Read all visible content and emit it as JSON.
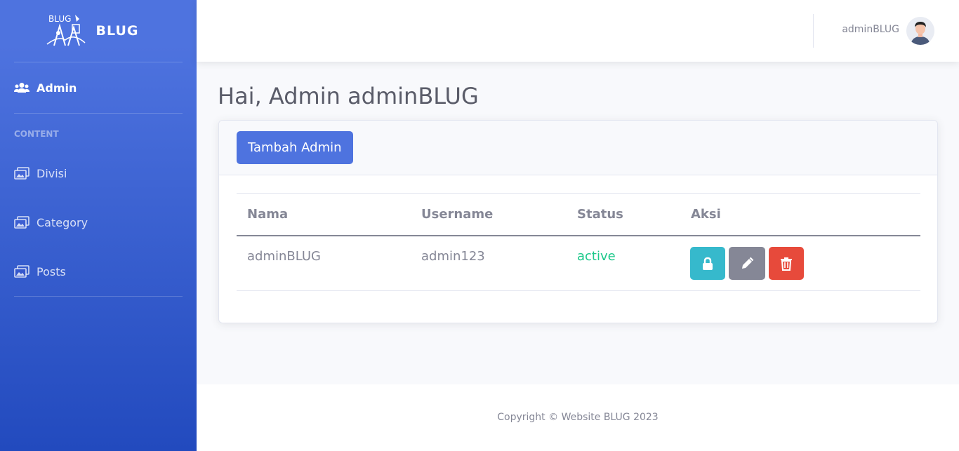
{
  "brand": {
    "name": "BLUG",
    "logo_text": "BLUG"
  },
  "sidebar": {
    "items": [
      {
        "label": "Admin",
        "icon": "users-icon",
        "active": true
      }
    ],
    "heading": "CONTENT",
    "content_items": [
      {
        "label": "Divisi",
        "icon": "images-icon"
      },
      {
        "label": "Category",
        "icon": "images-icon"
      },
      {
        "label": "Posts",
        "icon": "images-icon"
      }
    ]
  },
  "topbar": {
    "user_name": "adminBLUG",
    "avatar_icon": "user-avatar-icon"
  },
  "page": {
    "title": "Hai, Admin adminBLUG"
  },
  "card": {
    "add_button": "Tambah Admin",
    "table": {
      "columns": [
        "Nama",
        "Username",
        "Status",
        "Aksi"
      ],
      "rows": [
        {
          "nama": "adminBLUG",
          "username": "admin123",
          "status": "active"
        }
      ],
      "actions": [
        "lock-icon",
        "pencil-icon",
        "trash-icon"
      ]
    }
  },
  "footer": {
    "copyright": "Copyright © Website BLUG 2023"
  },
  "colors": {
    "primary": "#4e73df",
    "info": "#36b9cc",
    "secondary": "#858796",
    "danger": "#e74a3b",
    "success": "#1cc88a"
  }
}
